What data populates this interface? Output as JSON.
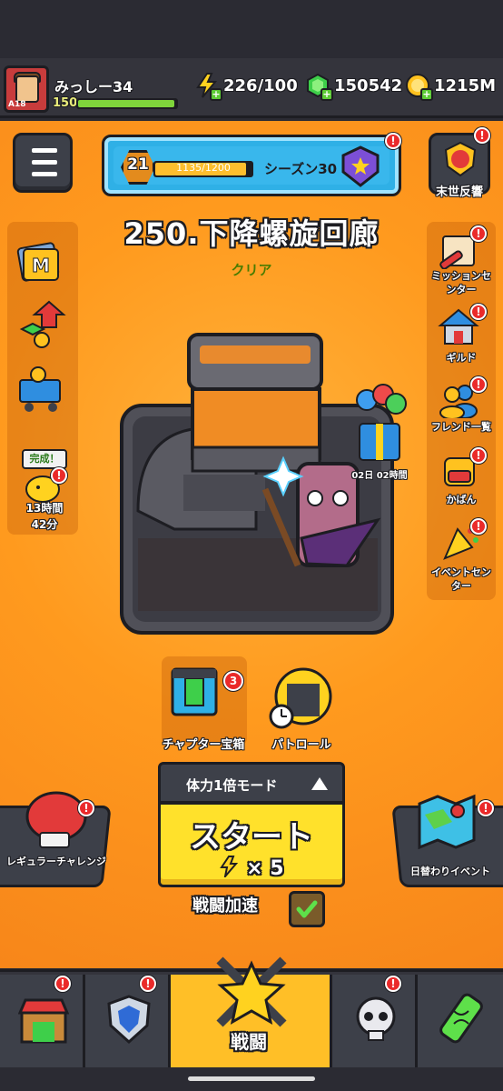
{
  "player": {
    "name": "みっしー34",
    "level": "150",
    "avatar_level": "A18",
    "xp_fraction": 0.98
  },
  "resources": {
    "energy": "226/100",
    "gems": "150542",
    "coins": "1215M"
  },
  "season": {
    "level": "21",
    "progress_text": "1135/1200",
    "progress_value": 1135,
    "progress_max": 1200,
    "label": "シーズン30"
  },
  "top_right": {
    "label": "末世反響"
  },
  "stage": {
    "title": "250.下降螺旋回廊",
    "status": "クリア"
  },
  "left_side": {
    "timer_badge": "完成！",
    "timer_line1": "13時間",
    "timer_line2": "42分"
  },
  "right_side": {
    "mission": "ミッションセンター",
    "guild": "ギルド",
    "friends": "フレンド一覧",
    "bag": "かばん",
    "event": "イベントセンター",
    "gift_timer": "02日 02時間"
  },
  "actions": {
    "chapter_chest": "チャプター宝箱",
    "chapter_chest_count": "3",
    "patrol": "パトロール"
  },
  "start": {
    "mode": "体力1倍モード",
    "label": "スタート",
    "cost": "× 5",
    "speed_label": "戦闘加速"
  },
  "side_buttons": {
    "regular": "レギュラーチャレンジ",
    "daily": "日替わりイベント"
  },
  "nav": {
    "battle": "戦闘"
  },
  "badge": {
    "exclaim": "!"
  },
  "colors": {
    "background": "#ff9a1e",
    "start": "#ffe12b",
    "accent_blue": "#2fb0e6"
  }
}
